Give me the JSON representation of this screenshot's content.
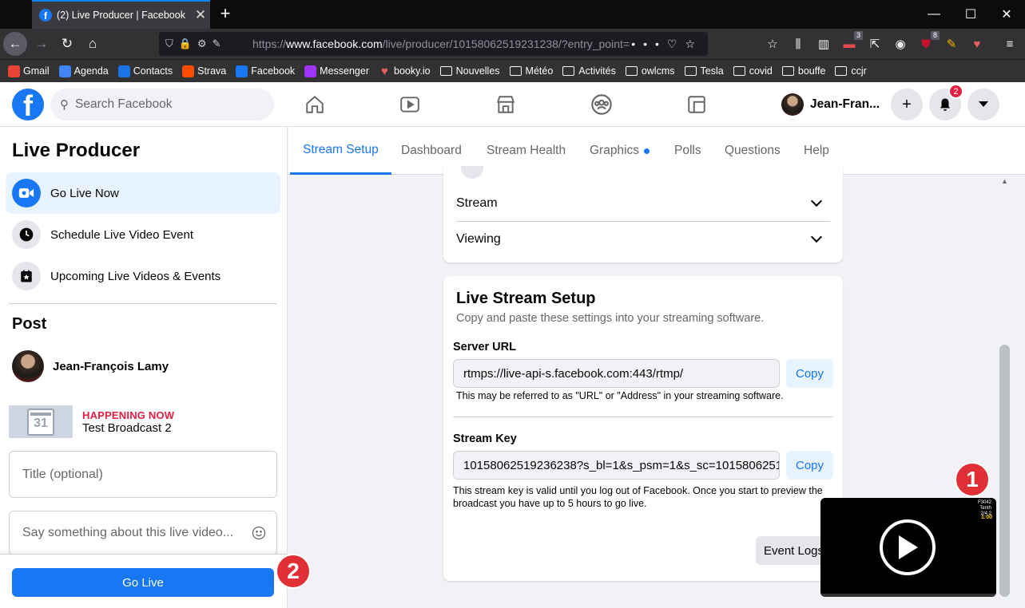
{
  "browser": {
    "tab_title": "(2) Live Producer | Facebook",
    "url_host": "www.facebook.com",
    "url_prefix": "https://",
    "url_rest": "/live/producer/10158062519231238/?entry_point=",
    "ext_badges": [
      "3",
      "8"
    ],
    "bookmarks": [
      {
        "label": "Gmail",
        "icon": "gmail-icon",
        "color": "#ea4335"
      },
      {
        "label": "Agenda",
        "icon": "calendar-icon",
        "color": "#4285f4"
      },
      {
        "label": "Contacts",
        "icon": "contacts-icon",
        "color": "#1a73e8"
      },
      {
        "label": "Strava",
        "icon": "strava-icon",
        "color": "#fc4c02"
      },
      {
        "label": "Facebook",
        "icon": "facebook-icon",
        "color": "#1877f2"
      },
      {
        "label": "Messenger",
        "icon": "messenger-icon",
        "color": "#a033ff"
      },
      {
        "label": "booky.io",
        "icon": "heart-icon",
        "color": "#e66060"
      },
      {
        "label": "Nouvelles",
        "icon": "folder-icon"
      },
      {
        "label": "Météo",
        "icon": "folder-icon"
      },
      {
        "label": "Activités",
        "icon": "folder-icon"
      },
      {
        "label": "owlcms",
        "icon": "folder-icon"
      },
      {
        "label": "Tesla",
        "icon": "folder-icon"
      },
      {
        "label": "covid",
        "icon": "folder-icon"
      },
      {
        "label": "bouffe",
        "icon": "folder-icon"
      },
      {
        "label": "ccjr",
        "icon": "folder-icon"
      }
    ]
  },
  "header": {
    "search_placeholder": "Search Facebook",
    "user_name": "Jean-Fran...",
    "notif_count": "2"
  },
  "sidebar": {
    "title": "Live Producer",
    "items": [
      {
        "label": "Go Live Now",
        "icon": "video-camera-icon",
        "active": true
      },
      {
        "label": "Schedule Live Video Event",
        "icon": "clock-icon",
        "active": false
      },
      {
        "label": "Upcoming Live Videos & Events",
        "icon": "star-calendar-icon",
        "active": false
      }
    ],
    "post_heading": "Post",
    "post_user": "Jean-François Lamy",
    "event": {
      "calendar_day": "31",
      "status": "HAPPENING NOW",
      "name": "Test Broadcast 2"
    },
    "title_placeholder": "Title (optional)",
    "description_placeholder": "Say something about this live video...",
    "go_live_label": "Go Live"
  },
  "tabs": [
    {
      "label": "Stream Setup",
      "active": true
    },
    {
      "label": "Dashboard"
    },
    {
      "label": "Stream Health"
    },
    {
      "label": "Graphics",
      "dot": true
    },
    {
      "label": "Polls"
    },
    {
      "label": "Questions"
    },
    {
      "label": "Help"
    }
  ],
  "settings_accordion": [
    "Stream",
    "Viewing"
  ],
  "stream_setup": {
    "title": "Live Stream Setup",
    "subtitle": "Copy and paste these settings into your streaming software.",
    "server_url_label": "Server URL",
    "server_url_value": "rtmps://live-api-s.facebook.com:443/rtmp/",
    "server_url_help": "This may be referred to as \"URL\" or \"Address\" in your streaming software.",
    "stream_key_label": "Stream Key",
    "stream_key_value": "10158062519236238?s_bl=1&s_psm=1&s_sc=1015806251",
    "stream_key_help": "This stream key is valid until you log out of Facebook. Once you start to preview the broadcast you have up to 5 hours to go live.",
    "copy_label": "Copy",
    "event_logs_label": "Event Logs"
  },
  "preview": {
    "score_lines": [
      "F3042",
      "Tenth",
      "2/4 2"
    ],
    "score_time": "1:00"
  },
  "annotations": {
    "marker_1": "1",
    "marker_2": "2",
    "color": "#e02f35"
  }
}
